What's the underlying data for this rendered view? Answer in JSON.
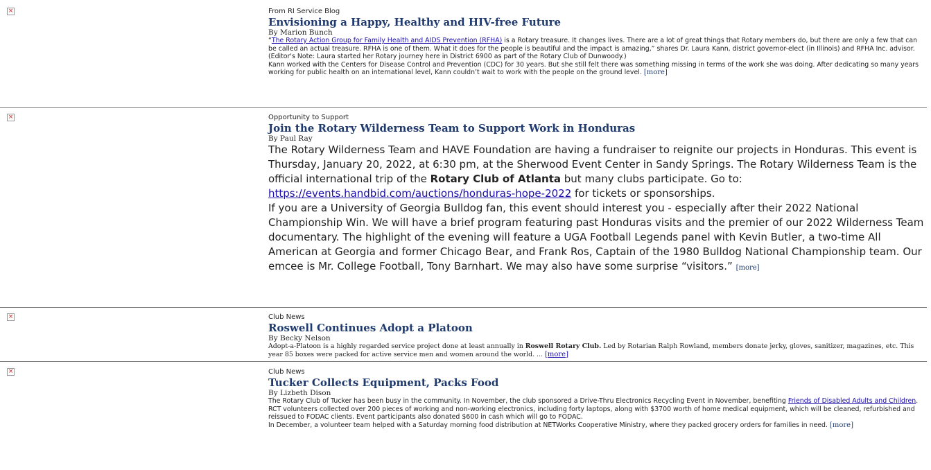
{
  "articles": [
    {
      "category": "From RI Service Blog",
      "title": "Envisioning a Happy, Healthy and HIV-free Future",
      "byline": "By Marion Bunch",
      "p1": {
        "quote_open": "“",
        "link": "The Rotary Action Group for Family Health and AIDS Prevention (RFHA)",
        "text": " is a Rotary treasure. It changes lives. There are a lot of great things that Rotary members do, but there are only a few that can be called an actual treasure. RFHA is one of them. What it does for the people is beautiful and the impact is amazing,” shares Dr. Laura Kann, district governor-elect (in Illinois) and RFHA Inc. advisor. (Editor's Note: Laura started her Rotary journey here in District 6900 as part of the Rotary Club of Dunwoody.)"
      },
      "p2": "Kann worked with the Centers for Disease Control and Prevention (CDC) for 30 years. But she still felt there was something missing in terms of the work she was doing. After dedicating so many years working for public health on an international level, Kann couldn’t wait to work with the people on the ground level. ",
      "more": "[more]"
    },
    {
      "category": "Opportunity to Support",
      "title": "Join the Rotary Wilderness Team to Support Work in Honduras",
      "byline": "By Paul Ray",
      "p1": {
        "text_a": "The Rotary Wilderness Team and HAVE Foundation are having a fundraiser to reignite our projects in Honduras. This event is Thursday, January 20, 2022, at 6:30 pm, at the Sherwood Event Center in Sandy Springs.  The Rotary Wilderness Team is the official international trip of the ",
        "bold": "Rotary Club of Atlanta",
        "text_b": " but many clubs participate. Go to: ",
        "link": "https://events.handbid.com/auctions/honduras-hope-2022",
        "text_c": " for tickets or sponsorships."
      },
      "p2": "If you are a University of Georgia Bulldog fan, this event should interest you - especially after their 2022 National Championship Win. We will have a brief program featuring past Honduras visits and the premier of our 2022 Wilderness Team documentary. The highlight of the evening will feature a UGA Football Legends panel with Kevin Butler, a two-time All American at Georgia and former Chicago Bear, and Frank Ros, Captain of the 1980 Bulldog National Championship team. Our emcee is Mr. College Football, Tony Barnhart. We may also have some surprise “visitors.” ",
      "more": "[more]"
    },
    {
      "category": "Club News",
      "title": "Roswell Continues Adopt a Platoon",
      "byline": "By Becky Nelson",
      "p1": {
        "text_a": "Adopt-a-Platoon is a highly regarded service project done at least annually in ",
        "bold": "Roswell Rotary Club.",
        "text_b": "  Led by Rotarian Ralph Rowland, members donate jerky, gloves, sanitizer, magazines, etc.  This year 85 boxes were packed for active service men and women around the world.  ... "
      },
      "more": "[more]"
    },
    {
      "category": "Club News",
      "title": "Tucker Collects Equipment, Packs Food",
      "byline": "By Lizbeth Dison",
      "p1": {
        "text_a": "The Rotary Club of Tucker has been busy in the community. In November, the club sponsored a Drive-Thru Electronics Recycling Event in November, benefiting ",
        "link": "Friends of Disabled Adults and Children",
        "text_b": ". RCT volunteers collected over 200 pieces of working and non-working electronics, including forty laptops, along with $3700 worth of home medical equipment, which will be cleaned, refurbished and reissued to FODAC clients. Event participants also donated $600 in cash which will go to FODAC."
      },
      "p2": "In December, a volunteer team helped with a Saturday morning food distribution at NETWorks Cooperative Ministry, where they packed grocery orders for families in need.  ",
      "more": "[more]"
    }
  ],
  "icons": {
    "broken_image": "broken-image-icon",
    "broken_image_glyph": "×"
  }
}
